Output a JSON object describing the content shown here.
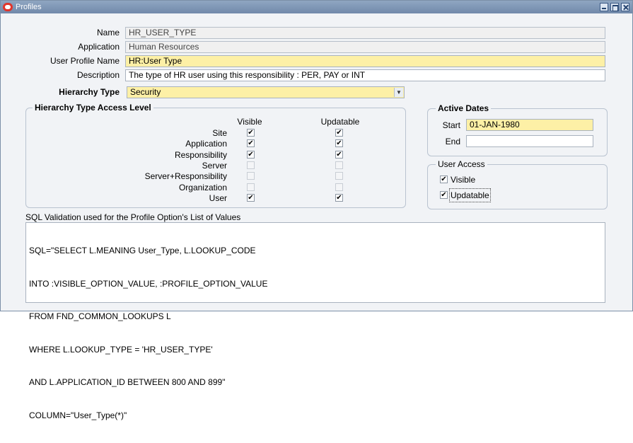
{
  "window": {
    "title": "Profiles"
  },
  "form": {
    "name_label": "Name",
    "name_value": "HR_USER_TYPE",
    "application_label": "Application",
    "application_value": "Human Resources",
    "user_profile_name_label": "User Profile Name",
    "user_profile_name_value": "HR:User Type",
    "description_label": "Description",
    "description_value": "The type of HR user using this responsibility : PER, PAY or INT",
    "hierarchy_type_label": "Hierarchy Type",
    "hierarchy_type_value": "Security"
  },
  "access_level": {
    "title": "Hierarchy Type Access Level",
    "visible_header": "Visible",
    "updatable_header": "Updatable",
    "rows": [
      {
        "label": "Site",
        "visible": true,
        "updatable": true
      },
      {
        "label": "Application",
        "visible": true,
        "updatable": true
      },
      {
        "label": "Responsibility",
        "visible": true,
        "updatable": true
      },
      {
        "label": "Server",
        "visible": false,
        "updatable": false
      },
      {
        "label": "Server+Responsibility",
        "visible": false,
        "updatable": false
      },
      {
        "label": "Organization",
        "visible": false,
        "updatable": false
      },
      {
        "label": "User",
        "visible": true,
        "updatable": true
      }
    ]
  },
  "active_dates": {
    "title": "Active Dates",
    "start_label": "Start",
    "start_value": "01-JAN-1980",
    "end_label": "End",
    "end_value": ""
  },
  "user_access": {
    "title": "User Access",
    "visible_label": "Visible",
    "visible_checked": true,
    "updatable_label": "Updatable",
    "updatable_checked": true
  },
  "sql": {
    "label": "SQL Validation used for the Profile Option's List of Values",
    "lines": [
      "SQL=\"SELECT L.MEANING User_Type, L.LOOKUP_CODE",
      "INTO :VISIBLE_OPTION_VALUE, :PROFILE_OPTION_VALUE",
      "FROM FND_COMMON_LOOKUPS L",
      "WHERE L.LOOKUP_TYPE = 'HR_USER_TYPE'",
      "AND L.APPLICATION_ID BETWEEN 800 AND 899\"",
      "COLUMN=\"User_Type(*)\""
    ]
  },
  "icons": {
    "app_logo": "oracle-logo-icon",
    "minimize": "minimize-icon",
    "maximize": "maximize-icon",
    "close": "close-icon",
    "check": "✔"
  }
}
